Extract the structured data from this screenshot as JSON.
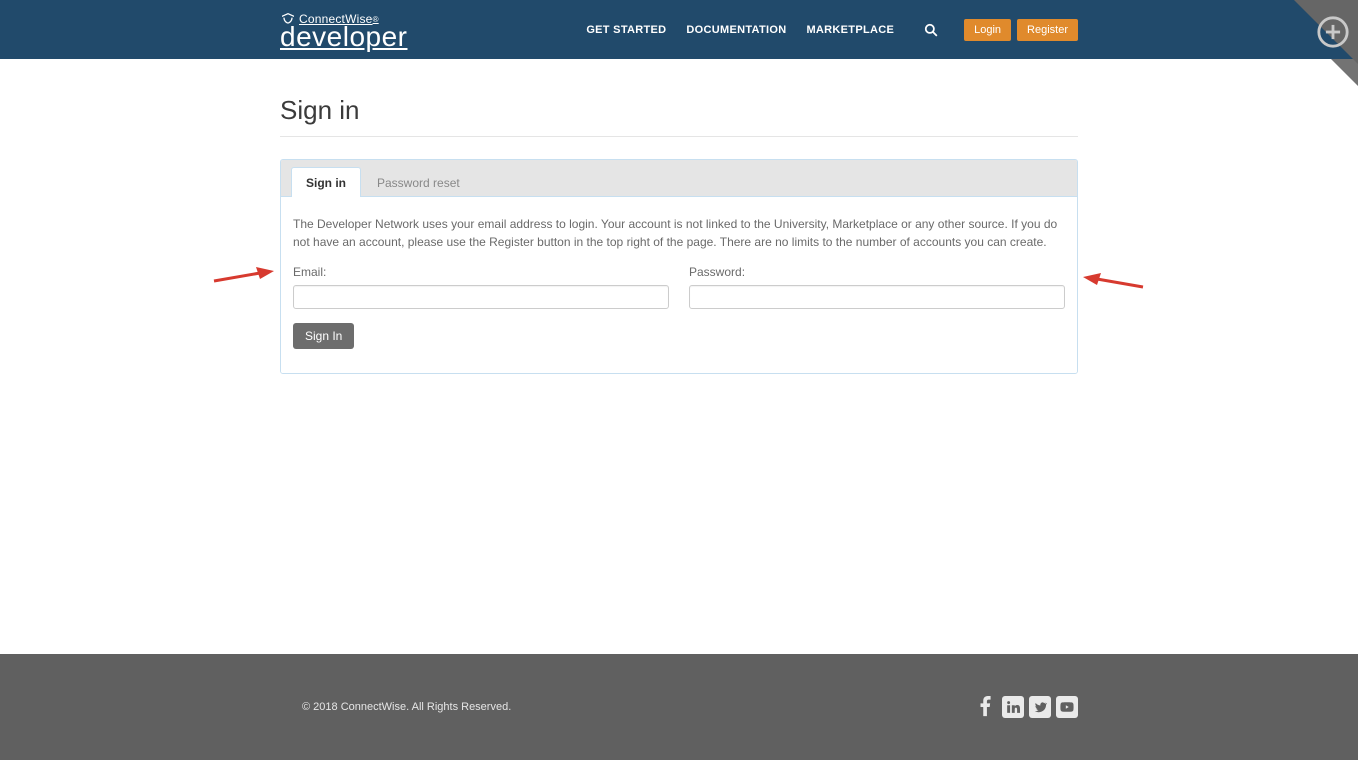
{
  "header": {
    "brand_top": "ConnectWise",
    "brand_bottom": "developer",
    "nav": {
      "get_started": "GET STARTED",
      "documentation": "DOCUMENTATION",
      "marketplace": "MARKETPLACE"
    },
    "login_label": "Login",
    "register_label": "Register"
  },
  "page": {
    "title": "Sign in"
  },
  "tabs": {
    "signin": "Sign in",
    "password_reset": "Password reset"
  },
  "form": {
    "help_text": "The Developer Network uses your email address to login.  Your account is not linked to the University, Marketplace or any other source.  If you do not have an account, please use the Register button in the top right of the page.  There are no limits to the number of accounts you can create.",
    "email_label": "Email:",
    "password_label": "Password:",
    "email_value": "",
    "password_value": "",
    "submit_label": "Sign In"
  },
  "footer": {
    "copyright": "© 2018 ConnectWise. All Rights Reserved."
  },
  "icons": {
    "search": "search-icon",
    "plus": "plus-circle-icon",
    "facebook": "facebook-icon",
    "linkedin": "linkedin-icon",
    "twitter": "twitter-icon",
    "youtube": "youtube-icon"
  },
  "colors": {
    "header_bg": "#214a6b",
    "accent": "#e08a2c",
    "footer_bg": "#606060",
    "arrow": "#d73a2f"
  }
}
